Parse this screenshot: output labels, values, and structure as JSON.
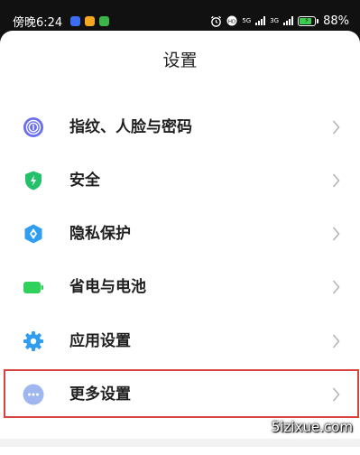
{
  "status_bar": {
    "time": "傍晚6:24",
    "app_icons": [
      {
        "name": "app-u-icon",
        "color": "#3b6ef5",
        "glyph": "U"
      },
      {
        "name": "app-orange-icon",
        "color": "#f5a623",
        "glyph": ""
      },
      {
        "name": "app-green-icon",
        "color": "#3bb54a",
        "glyph": ""
      }
    ],
    "network_5g": "5G",
    "network_3g": "3G",
    "battery_level": 0.88,
    "battery_percent": "88%",
    "accent_green": "#3bcf4f"
  },
  "sheet": {
    "title": "设置",
    "items": [
      {
        "label": "指纹、人脸与密码",
        "icon": "fingerprint-icon",
        "color": "#6a6ff0"
      },
      {
        "label": "安全",
        "icon": "shield-icon",
        "color": "#25c06b"
      },
      {
        "label": "隐私保护",
        "icon": "privacy-icon",
        "color": "#2f9df0"
      },
      {
        "label": "省电与电池",
        "icon": "battery-icon",
        "color": "#2fd15a"
      },
      {
        "label": "应用设置",
        "icon": "gear-icon",
        "color": "#2f9df0"
      },
      {
        "label": "更多设置",
        "icon": "more-icon",
        "color": "#9fb6ee"
      }
    ]
  },
  "highlight_color": "#d9433f",
  "watermark": "5izixue.com"
}
